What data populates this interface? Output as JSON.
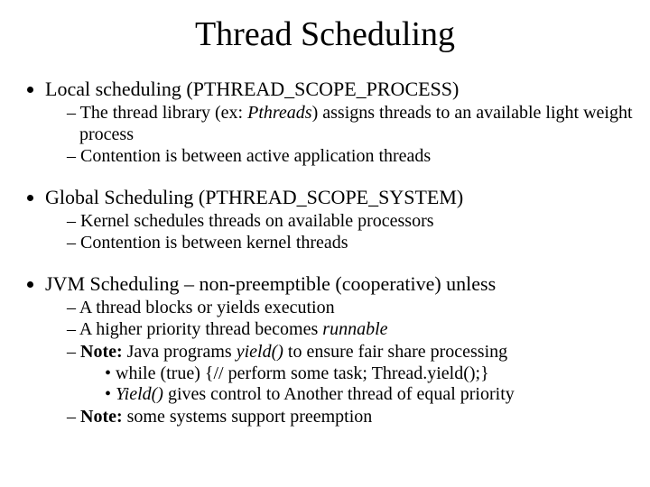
{
  "title": "Thread Scheduling",
  "b1": {
    "text": "Local scheduling (PTHREAD_SCOPE_PROCESS)",
    "s1a": "The thread library (ex: ",
    "s1b": "Pthreads",
    "s1c": ") assigns threads to an available light weight process",
    "s2": "Contention is between active application threads"
  },
  "b2": {
    "text": "Global Scheduling (PTHREAD_SCOPE_SYSTEM)",
    "s1": "Kernel schedules threads on available processors",
    "s2": "Contention is between kernel threads"
  },
  "b3": {
    "text": "JVM Scheduling – non-preemptible (cooperative) unless",
    "s1": "A thread blocks or yields execution",
    "s2a": "A higher priority thread becomes ",
    "s2b": "runnable",
    "s3a": "Note: ",
    "s3b": "Java programs ",
    "s3c": "yield() ",
    "s3d": "to ensure fair share processing",
    "s3_1": "while (true) {// perform some task;   Thread.yield();}",
    "s3_2a": "Yield()",
    "s3_2b": " gives control to Another thread of equal priority",
    "s4a": "Note: ",
    "s4b": "some systems support preemption"
  }
}
